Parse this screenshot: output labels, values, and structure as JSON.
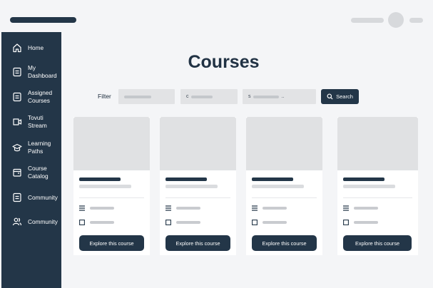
{
  "sidebar": {
    "items": [
      {
        "label": "Home",
        "icon": "home-icon"
      },
      {
        "label": "My\nDashboard",
        "icon": "dashboard-icon"
      },
      {
        "label": "Assigned\nCourses",
        "icon": "assigned-courses-icon"
      },
      {
        "label": "Tovuti\nStream",
        "icon": "stream-icon"
      },
      {
        "label": "Learning\nPaths",
        "icon": "graduation-cap-icon"
      },
      {
        "label": "Course\nCatalog",
        "icon": "catalog-icon"
      },
      {
        "label": "Community",
        "icon": "community-icon"
      },
      {
        "label": "Community",
        "icon": "users-icon"
      }
    ]
  },
  "main": {
    "title": "Courses",
    "filter": {
      "label": "Filter",
      "field_2_prefix": "c",
      "field_3_prefix": "s",
      "field_3_suffix": "..",
      "search_label": "Search"
    },
    "cards": [
      {
        "button_label": "Explore this course"
      },
      {
        "button_label": "Explore this course"
      },
      {
        "button_label": "Explore this course"
      },
      {
        "button_label": "Explore this course"
      }
    ]
  },
  "colors": {
    "primary": "#233648",
    "background": "#f4f5f7",
    "placeholder": "#e0e1e3"
  }
}
